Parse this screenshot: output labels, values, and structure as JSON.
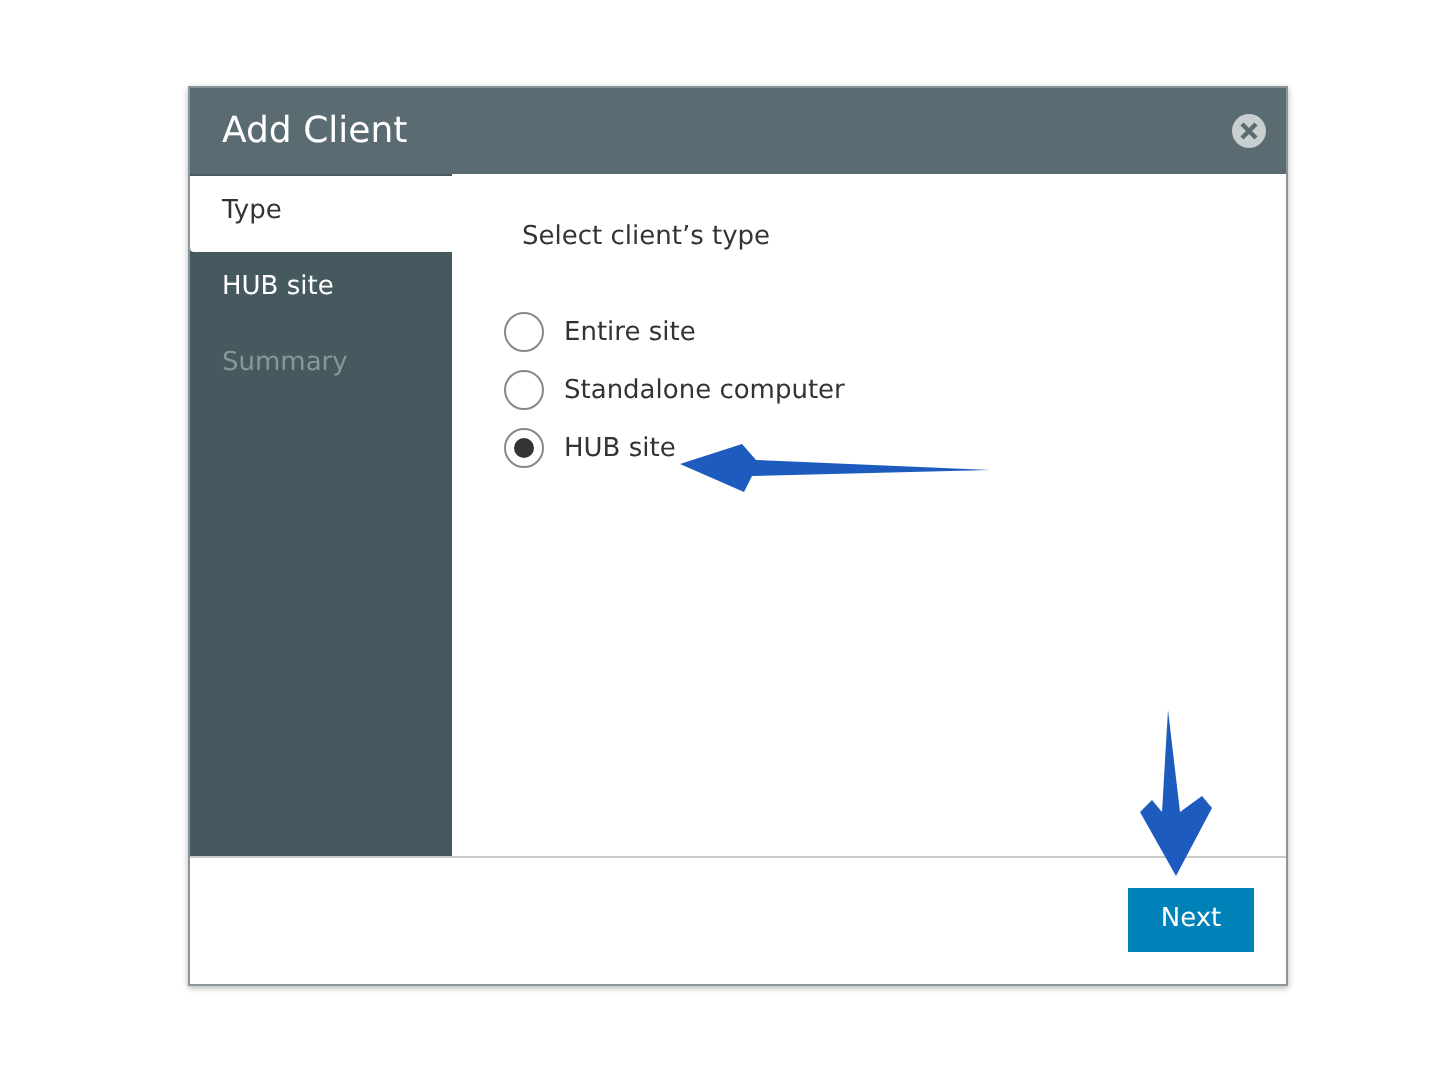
{
  "window": {
    "title": "Add Client"
  },
  "steps": [
    {
      "label": "Type",
      "selected": true,
      "disabled": false
    },
    {
      "label": "HUB site",
      "selected": false,
      "disabled": false
    },
    {
      "label": "Summary",
      "selected": false,
      "disabled": true
    }
  ],
  "prompt": "Select client’s type",
  "options": [
    {
      "label": "Entire site",
      "selected": false
    },
    {
      "label": "Standalone computer",
      "selected": false
    },
    {
      "label": "HUB site",
      "selected": true
    }
  ],
  "buttons": [
    "Next"
  ]
}
